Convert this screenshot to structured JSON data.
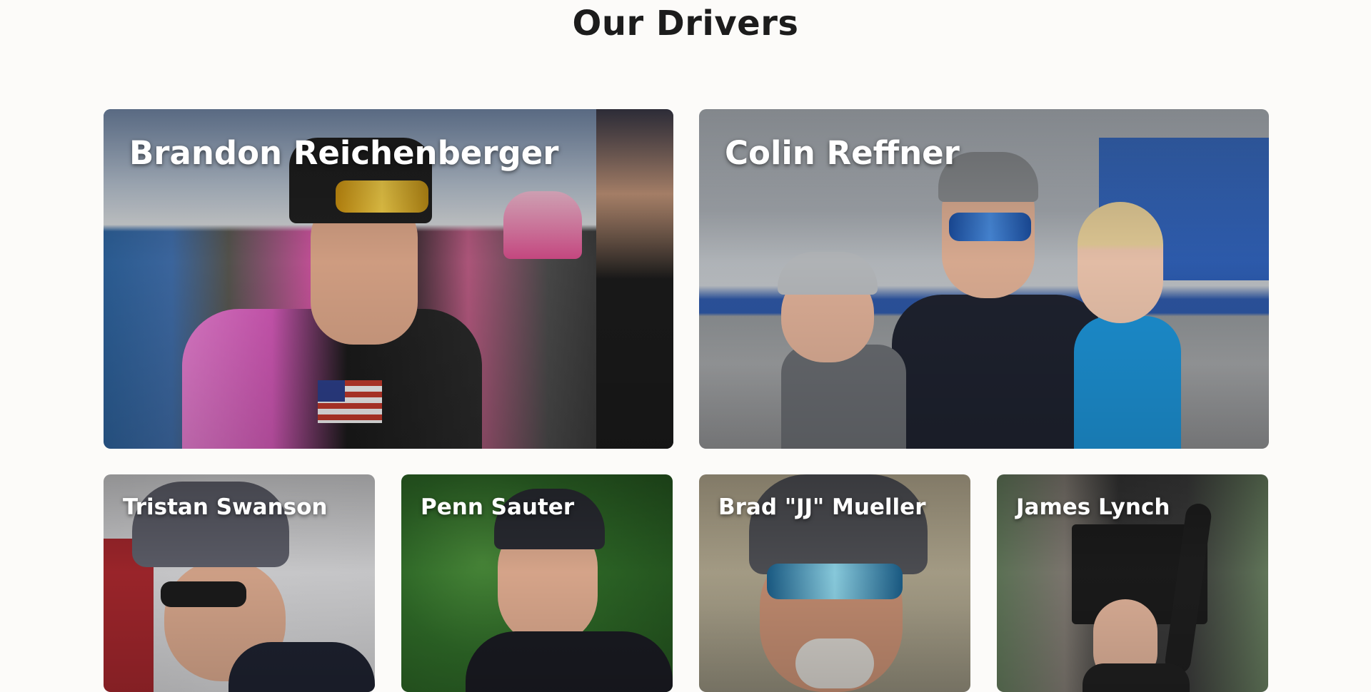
{
  "page": {
    "title": "Our Drivers"
  },
  "drivers": [
    {
      "name": "Brandon Reichenberger"
    },
    {
      "name": "Colin Reffner"
    },
    {
      "name": "Tristan Swanson"
    },
    {
      "name": "Penn Sauter"
    },
    {
      "name": "Brad \"JJ\" Mueller"
    },
    {
      "name": "James Lynch"
    }
  ],
  "colors": {
    "background": "#fcfbf9",
    "heading": "#1c1c1c",
    "card_text": "#ffffff"
  }
}
